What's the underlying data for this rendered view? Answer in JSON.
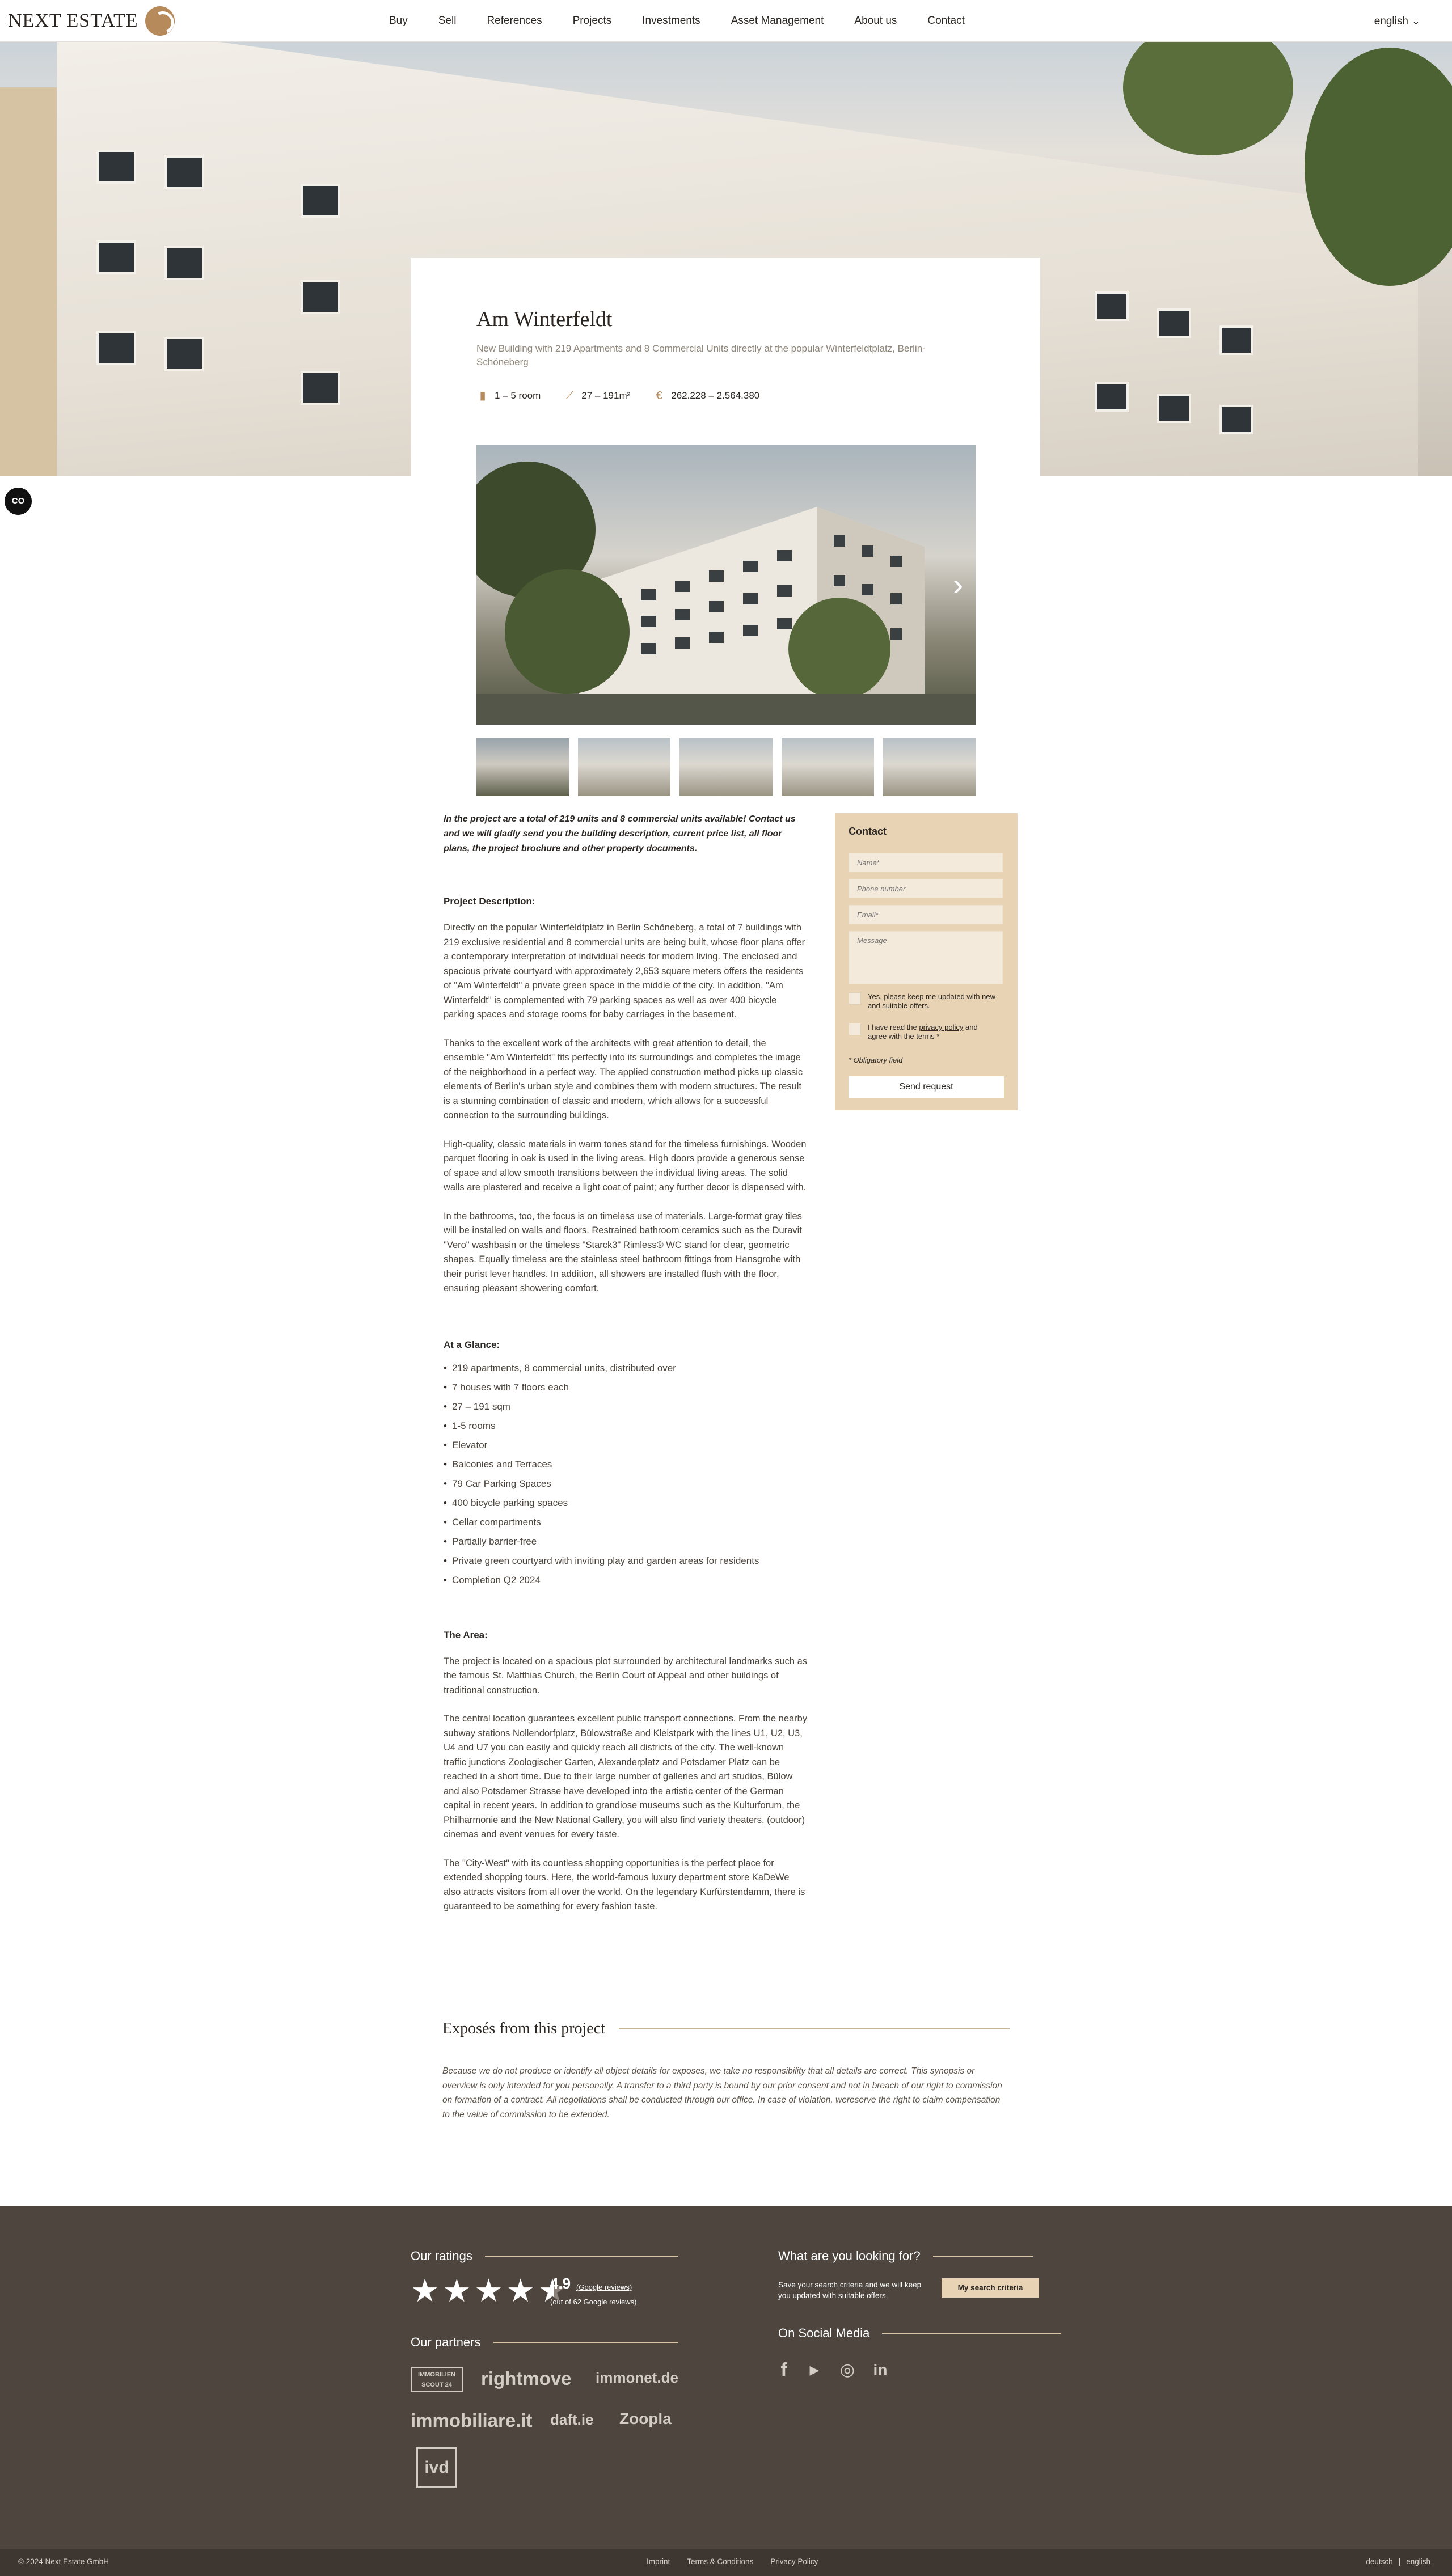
{
  "header": {
    "logo_text": "NEXT ESTATE",
    "nav": [
      "Buy",
      "Sell",
      "References",
      "Projects",
      "Investments",
      "Asset Management",
      "About us",
      "Contact"
    ],
    "language": "english"
  },
  "project": {
    "title": "Am Winterfeldt",
    "subtitle": "New Building with 219 Apartments and 8 Commercial Units directly at the popular Winterfeldtplatz, Berlin-Schöneberg",
    "facts": [
      {
        "icon": "door-icon",
        "text": "1 – 5 room"
      },
      {
        "icon": "ruler-icon",
        "text": "27 – 191m²"
      },
      {
        "icon": "euro-icon",
        "text": "262.228 – 2.564.380"
      }
    ]
  },
  "side_chip": "CO",
  "content": {
    "intro": "In the project are a total of 219 units and 8 commercial units available! Contact us and we will gladly send you the building description, current price list, all floor plans, the project brochure and other property documents.",
    "description_head": "Project Description:",
    "description_paras": [
      "Directly on the popular Winterfeldtplatz in Berlin Schöneberg, a total of 7 buildings with 219 exclusive residential and 8 commercial units are being built, whose floor plans offer a contemporary interpretation of individual needs for modern living. The enclosed and spacious private courtyard with approximately 2,653 square meters offers the residents of \"Am Winterfeldt\" a private green space in the middle of the city. In addition, \"Am Winterfeldt\" is complemented with 79 parking spaces as well as over 400 bicycle parking spaces and storage rooms for baby carriages in the basement.",
      "Thanks to the excellent work of the architects with great attention to detail, the ensemble \"Am Winterfeldt\" fits perfectly into its surroundings and completes the image of the neighborhood in a perfect way. The applied construction method picks up classic elements of Berlin's urban style and combines them with modern structures. The result is a stunning combination of classic and modern, which allows for a successful connection to the surrounding buildings.",
      "High-quality, classic materials in warm tones stand for the timeless furnishings. Wooden parquet flooring in oak is used in the living areas. High doors provide a generous sense of space and allow smooth transitions between the individual living areas. The solid walls are plastered and receive a light coat of paint; any further decor is dispensed with.",
      "In the bathrooms, too, the focus is on timeless use of materials. Large-format gray tiles will be installed on walls and floors. Restrained bathroom ceramics such as the Duravit \"Vero\" washbasin or the timeless \"Starck3\" Rimless® WC stand for clear, geometric shapes. Equally timeless are the stainless steel bathroom fittings from Hansgrohe with their purist lever handles. In addition, all showers are installed flush with the floor, ensuring pleasant showering comfort."
    ],
    "glance_head": "At a Glance:",
    "glance_items": [
      "219 apartments, 8 commercial units, distributed over",
      "7 houses with 7 floors each",
      "27 – 191 sqm",
      "1-5 rooms",
      "Elevator",
      "Balconies and Terraces",
      "79 Car Parking Spaces",
      "400 bicycle parking spaces",
      "Cellar compartments",
      "Partially barrier-free",
      "Private green courtyard with inviting play and garden areas for residents",
      "Completion Q2 2024"
    ],
    "area_head": "The Area:",
    "area_paras": [
      "The project is located on a spacious plot surrounded by architectural landmarks such as the famous St. Matthias Church, the Berlin Court of Appeal and other buildings of traditional construction.",
      "The central location guarantees excellent public transport connections. From the nearby subway stations Nollendorfplatz, Bülowstraße and Kleistpark with the lines U1, U2, U3, U4 and U7 you can easily and quickly reach all districts of the city. The well-known traffic junctions Zoologischer Garten, Alexanderplatz and Potsdamer Platz can be reached in a short time. Due to their large number of galleries and art studios, Bülow and also Potsdamer Strasse have developed into the artistic center of the German capital in recent years. In addition to grandiose museums such as the Kulturforum, the Philharmonie and the New National Gallery, you will also find variety theaters, (outdoor) cinemas and event venues for every taste.",
      "The \"City-West\" with its countless shopping opportunities is the perfect place for extended shopping tours. Here, the world-famous luxury department store KaDeWe also attracts visitors from all over the world. On the legendary Kurfürstendamm, there is guaranteed to be something for every fashion taste."
    ]
  },
  "contact_form": {
    "title": "Contact",
    "name_placeholder": "Name*",
    "phone_placeholder": "Phone number",
    "email_placeholder": "Email*",
    "message_placeholder": "Message",
    "newsletter_label": "Yes, please keep me updated with new and suitable offers.",
    "privacy_pre": "I have read the ",
    "privacy_link": "privacy policy",
    "privacy_post": " and agree with the terms *",
    "required_note": "* Obligatory field",
    "send_label": "Send request"
  },
  "exposes": {
    "title": "Exposés from this project",
    "disclaimer": "Because we do not produce or identify all object details for exposes, we take no responsibility that all details are correct. This synopsis or overview is only intended for you personally. A transfer to a third party is bound by our prior consent and not in breach of our right to commission on formation of a contract. All negotiations shall be conducted through our office. In case of violation, wereserve the right to claim compensation to the value of commission to be extended."
  },
  "footer": {
    "ratings_head": "Our ratings",
    "rating_value": "4.9",
    "rating_stars": 4.5,
    "rating_link": "(Google reviews)",
    "rating_count": "(out of 62 Google reviews)",
    "partners_head": "Our partners",
    "partners": [
      "IMMOBILIEN SCOUT 24",
      "rightmove",
      "immonet.de",
      "immobiliare.it",
      "daft.ie",
      "Zoopla",
      "ivd"
    ],
    "search_head": "What are you looking for?",
    "search_text": "Save your search criteria and we will keep you updated with suitable offers.",
    "search_button": "My search criteria",
    "social_head": "On Social Media",
    "social": [
      "facebook-icon",
      "youtube-icon",
      "instagram-icon",
      "linkedin-icon"
    ]
  },
  "bottom_bar": {
    "copyright": "© 2024 Next Estate GmbH",
    "links": [
      "Imprint",
      "Terms & Conditions",
      "Privacy Policy"
    ],
    "lang_de": "deutsch",
    "lang_sep": "|",
    "lang_en": "english"
  }
}
